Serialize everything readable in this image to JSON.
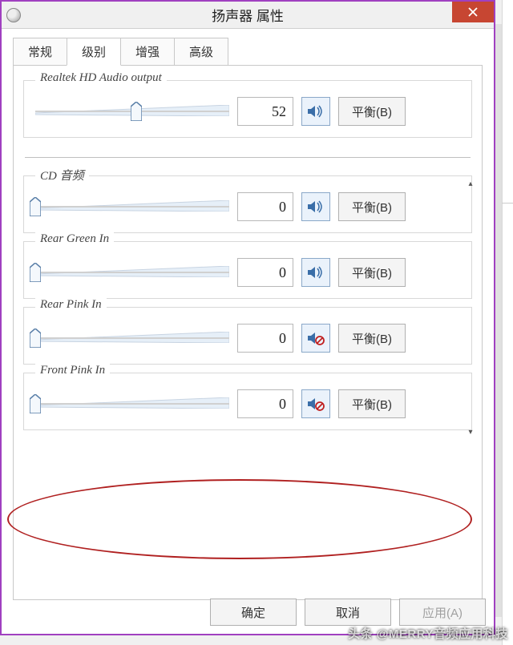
{
  "window": {
    "title": "扬声器 属性"
  },
  "tabs": [
    {
      "label": "常规",
      "active": false
    },
    {
      "label": "级别",
      "active": true
    },
    {
      "label": "增强",
      "active": false
    },
    {
      "label": "高级",
      "active": false
    }
  ],
  "main_group": {
    "label": "Realtek HD Audio output",
    "value": "52",
    "slider_percent": 52,
    "muted": false,
    "balance_label": "平衡(B)"
  },
  "groups": [
    {
      "label": "CD 音频",
      "value": "0",
      "slider_percent": 0,
      "muted": false,
      "balance_label": "平衡(B)"
    },
    {
      "label": "Rear Green In",
      "value": "0",
      "slider_percent": 0,
      "muted": false,
      "balance_label": "平衡(B)"
    },
    {
      "label": "Rear Pink In",
      "value": "0",
      "slider_percent": 0,
      "muted": true,
      "balance_label": "平衡(B)"
    },
    {
      "label": "Front Pink In",
      "value": "0",
      "slider_percent": 0,
      "muted": true,
      "balance_label": "平衡(B)"
    }
  ],
  "buttons": {
    "ok": "确定",
    "cancel": "取消",
    "apply": "应用(A)"
  },
  "watermark": "头条 @MERRY音频应用科技"
}
